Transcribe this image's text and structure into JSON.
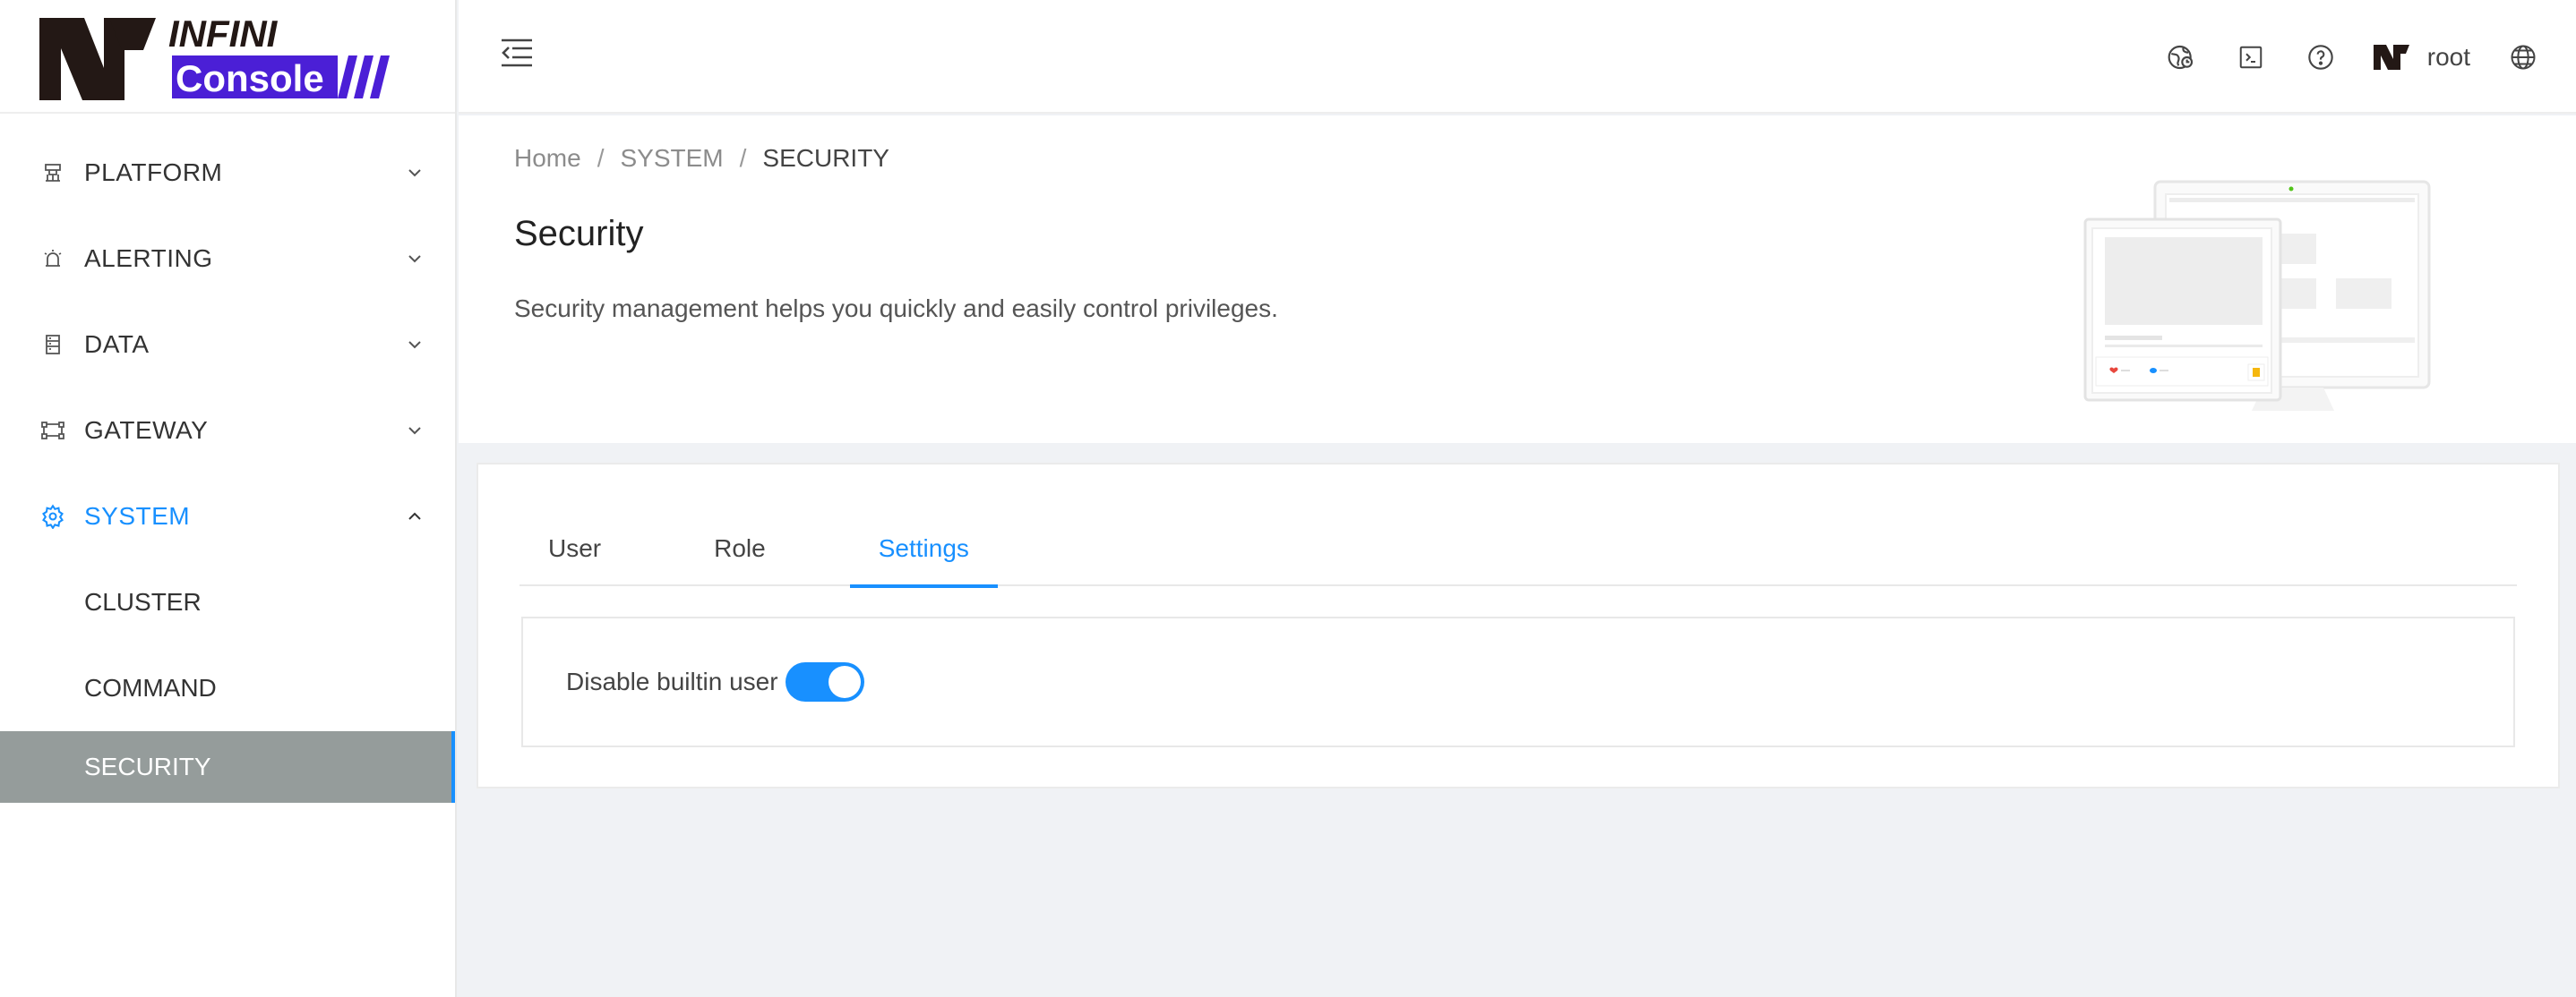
{
  "app": {
    "logo_top": "INFINI",
    "logo_bottom": "Console"
  },
  "sidebar": {
    "items": [
      {
        "label": "PLATFORM",
        "icon": "platform-icon"
      },
      {
        "label": "ALERTING",
        "icon": "alarm-icon"
      },
      {
        "label": "DATA",
        "icon": "database-icon"
      },
      {
        "label": "GATEWAY",
        "icon": "gateway-icon"
      },
      {
        "label": "SYSTEM",
        "icon": "gear-icon"
      }
    ],
    "system_sub": [
      "CLUSTER",
      "COMMAND",
      "SECURITY"
    ]
  },
  "header": {
    "username": "root"
  },
  "breadcrumb": [
    "Home",
    "SYSTEM",
    "SECURITY"
  ],
  "page": {
    "title": "Security",
    "description": "Security management helps you quickly and easily control privileges."
  },
  "tabs": [
    "User",
    "Role",
    "Settings"
  ],
  "settings": {
    "disable_builtin_label": "Disable builtin user",
    "disable_builtin_enabled": true
  },
  "colors": {
    "accent": "#1890ff",
    "selected_bg": "#959c9b",
    "logo_purple": "#4b1fd6"
  }
}
